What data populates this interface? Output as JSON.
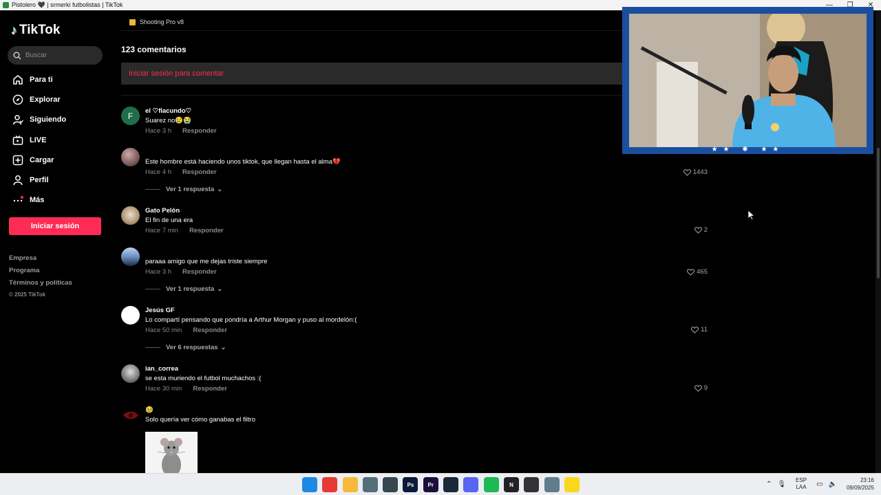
{
  "window": {
    "title": "Pistolero 🖤 | srmerki futbolistas | TikTok",
    "controls": [
      "—",
      "❐",
      "✕"
    ]
  },
  "sidebar": {
    "logo": "TikTok",
    "search_placeholder": "Buscar",
    "nav": [
      {
        "label": "Para ti",
        "icon": "home-icon"
      },
      {
        "label": "Explorar",
        "icon": "compass-icon"
      },
      {
        "label": "Siguiendo",
        "icon": "following-icon"
      },
      {
        "label": "LIVE",
        "icon": "live-icon"
      },
      {
        "label": "Cargar",
        "icon": "upload-icon"
      },
      {
        "label": "Perfil",
        "icon": "profile-icon"
      },
      {
        "label": "Más",
        "icon": "more-icon"
      }
    ],
    "login_button": "Iniciar sesión",
    "footer": [
      "Empresa",
      "Programa",
      "Términos y políticas"
    ],
    "copyright": "© 2025 TikTok"
  },
  "main": {
    "top_chip": "Shooting Pro v8",
    "comment_count": "123 comentarios",
    "login_to_comment": "Iniciar sesión para comentar",
    "reply_label": "Responder",
    "comments": [
      {
        "user": "el ♡flacundo♡",
        "text": "Suarez no😢😭",
        "time": "Hace 3 h",
        "likes": "",
        "avatar": "F",
        "replies": ""
      },
      {
        "user": "",
        "text": "Este hombre está haciendo unos tiktok, que llegan hasta el alma💔",
        "time": "Hace 4 h",
        "likes": "1443",
        "avatar": "",
        "replies": "Ver 1 respuesta"
      },
      {
        "user": "Gato Pelón",
        "text": "El fin de una era",
        "time": "Hace 7 min",
        "likes": "2",
        "avatar": "",
        "replies": ""
      },
      {
        "user": "",
        "text": "paraaa amigo que me dejas triste siempre",
        "time": "Hace 3 h",
        "likes": "465",
        "avatar": "",
        "replies": "Ver 1 respuesta"
      },
      {
        "user": "Jesús GF",
        "text": "Lo compartí pensando que pondría a Arthur Morgan y puso al mordelón:(",
        "time": "Hace 50 min",
        "likes": "11",
        "avatar": "",
        "replies": "Ver 6 respuestas"
      },
      {
        "user": "ian_correa",
        "text": "se esta muriendo el futbol muchachos :(",
        "time": "Hace 30 min",
        "likes": "9",
        "avatar": "",
        "replies": ""
      },
      {
        "user": "🥹",
        "text": "Solo quería ver cómo ganabas el filtro",
        "time": "",
        "likes": "",
        "avatar": "",
        "replies": ""
      }
    ]
  },
  "taskbar": {
    "lang_top": "ESP",
    "lang_bottom": "LAA",
    "time": "23:16",
    "date": "09/09/2025",
    "apps": [
      {
        "name": "windows-start-icon",
        "color": "#1e88e5",
        "label": ""
      },
      {
        "name": "chrome-icon",
        "color": "#e53935",
        "label": ""
      },
      {
        "name": "folder-icon",
        "color": "#f6b93b",
        "label": ""
      },
      {
        "name": "gallery-icon",
        "color": "#546e7a",
        "label": ""
      },
      {
        "name": "obs-icon",
        "color": "#37474f",
        "label": ""
      },
      {
        "name": "photoshop-icon",
        "color": "#0a1a3a",
        "label": "Ps"
      },
      {
        "name": "premiere-icon",
        "color": "#1b0f3b",
        "label": "Pr"
      },
      {
        "name": "steam-icon",
        "color": "#1b2838",
        "label": ""
      },
      {
        "name": "discord-icon",
        "color": "#5865f2",
        "label": ""
      },
      {
        "name": "spotify-icon",
        "color": "#1db954",
        "label": ""
      },
      {
        "name": "notion-icon",
        "color": "#222",
        "label": "N"
      },
      {
        "name": "steelseries-icon",
        "color": "#333",
        "label": ""
      },
      {
        "name": "settings-icon",
        "color": "#607d8b",
        "label": ""
      },
      {
        "name": "sticky-notes-icon",
        "color": "#f9d71c",
        "label": ""
      }
    ]
  }
}
